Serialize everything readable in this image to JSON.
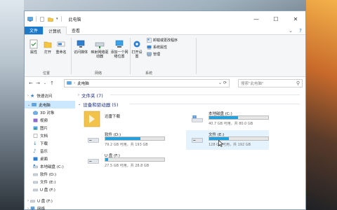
{
  "window": {
    "title": "此电脑",
    "controls": [
      "—",
      "☐",
      "✕"
    ],
    "help": "?",
    "expand": "⌄"
  },
  "tabs": [
    "文件",
    "计算机",
    "查看"
  ],
  "ribbon": {
    "location": {
      "label": "位置",
      "buttons": [
        "属性",
        "打开",
        "重命名"
      ]
    },
    "network": {
      "label": "网络",
      "buttons": [
        "访问媒体",
        "映射网络驱动器",
        "添加一个网络位置"
      ]
    },
    "system": {
      "label": "系统",
      "open_settings": "打开设置",
      "items": [
        "卸载或更改程序",
        "系统属性",
        "管理"
      ]
    }
  },
  "address": {
    "path": "此电脑",
    "search_placeholder": "搜索\"此电脑\""
  },
  "nav": {
    "quick_access": "快速访问",
    "this_pc": "此电脑",
    "items": [
      "3D 对象",
      "视频",
      "图片",
      "文档",
      "下载",
      "音乐",
      "桌面",
      "本地磁盘 (C:)",
      "软件 (D:)",
      "文件 (E:)",
      "U 盘 (F:)"
    ],
    "usb": "U 盘 (F:)",
    "network": "网络"
  },
  "content": {
    "folders_header": "文件夹 (7)",
    "devices_header": "设备和驱动器 (5)",
    "drives": [
      {
        "name": "迅雷下载",
        "type": "folder"
      },
      {
        "name": "本地磁盘 (C:)",
        "free": "40.7 GB 可用，共 80.0 GB",
        "used_fraction": 0.49
      },
      {
        "name": "软件 (D:)",
        "free": "79.2 GB 可用，共 193 GB",
        "used_fraction": 0.59
      },
      {
        "name": "文件 (E:)",
        "free": "128 GB 可用，共 192 GB",
        "used_fraction": 0.33
      },
      {
        "name": "U 盘 (F:)",
        "free": "27.5 GB 可用，共 28.8 GB",
        "used_fraction": 0.05
      }
    ]
  },
  "colors": {
    "accent": "#1979ca",
    "bar_fill": "#26a0da",
    "header_text": "#1e3287",
    "selection": "#cce8ff"
  }
}
